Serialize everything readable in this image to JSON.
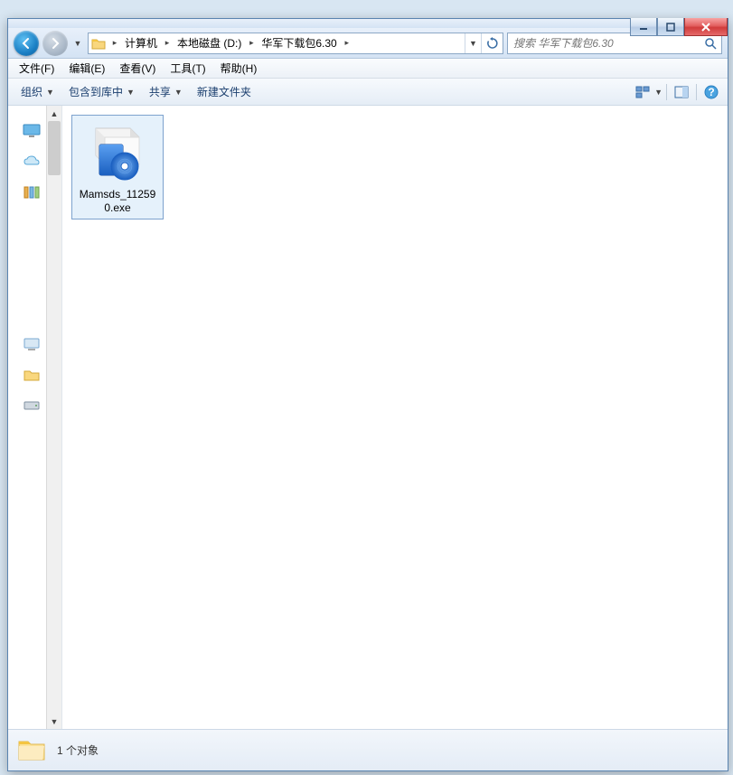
{
  "titlebar": {},
  "nav": {
    "breadcrumbs": [
      {
        "label": "计算机"
      },
      {
        "label": "本地磁盘 (D:)"
      },
      {
        "label": "华军下载包6.30"
      }
    ],
    "search_placeholder": "搜索 华军下载包6.30"
  },
  "menu": {
    "items": [
      "文件(F)",
      "编辑(E)",
      "查看(V)",
      "工具(T)",
      "帮助(H)"
    ]
  },
  "toolbar": {
    "organize": "组织",
    "include": "包含到库中",
    "share": "共享",
    "newfolder": "新建文件夹"
  },
  "files": [
    {
      "name": "Mamsds_11259",
      "ext": "0.exe"
    }
  ],
  "status": {
    "count_text": "1 个对象"
  }
}
